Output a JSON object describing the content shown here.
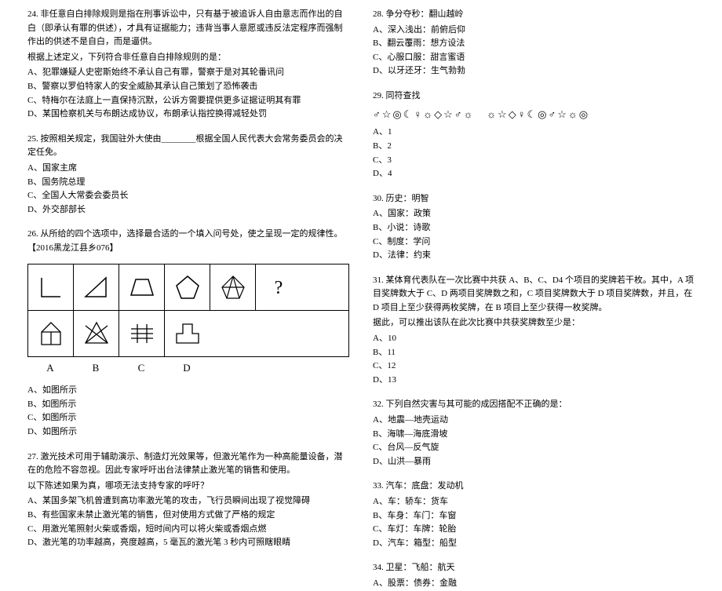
{
  "left": {
    "q24": {
      "text": "24. 非任意自白排除规则是指在刑事诉讼中，只有基于被追诉人自由意志而作出的自白（即承认有罪的供述），才具有证据能力；违背当事人意愿或违反法定程序而强制作出的供述不是自白，而是逼供。",
      "sub": "根据上述定义，下列符合非任意自白排除规则的是：",
      "a": "A、犯罪嫌疑人史密斯始终不承认自己有罪，警察于是对其轮番讯问",
      "b": "B、警察以罗伯特家人的安全威胁其承认自己策划了恐怖袭击",
      "c": "C、特梅尔在法庭上一直保持沉默，公诉方需要提供更多证据证明其有罪",
      "d": "D、某国检察机关与布朗达成协议，布朗承认指控换得减轻处罚"
    },
    "q25": {
      "text": "25. 按照相关规定，我国驻外大使由________根据全国人民代表大会常务委员会的决定任免。",
      "a": "A、国家主席",
      "b": "B、国务院总理",
      "c": "C、全国人大常委会委员长",
      "d": "D、外交部部长"
    },
    "q26": {
      "text": "26. 从所给的四个选项中，选择最合适的一个填入问号处，使之呈现一定的规律性。【2016黑龙江县乡076】",
      "a": "A、如图所示",
      "b": "B、如图所示",
      "c": "C、如图所示",
      "d": "D、如图所示",
      "labelA": "A",
      "labelB": "B",
      "labelC": "C",
      "labelD": "D"
    },
    "q27": {
      "text": "27. 激光技术可用于辅助演示、制造灯光效果等，但激光笔作为一种高能量设备，潜在的危险不容忽视。因此专家呼吁出台法律禁止激光笔的销售和使用。",
      "sub": "以下陈述如果为真，哪项无法支持专家的呼吁？",
      "a": "A、某国多架飞机曾遭到高功率激光笔的攻击，飞行员瞬间出现了视觉障碍",
      "b": "B、有些国家未禁止激光笔的销售，但对使用方式做了严格的规定",
      "c": "C、用激光笔照射火柴或香烟，短时间内可以将火柴或香烟点燃",
      "d": "D、激光笔的功率越高，亮度越高，5 毫瓦的激光笔 3 秒内可照瞎眼睛"
    }
  },
  "right": {
    "q28": {
      "text": "28. 争分夺秒：翻山越岭",
      "a": "A、深入浅出：前俯后仰",
      "b": "B、翻云覆雨：想方设法",
      "c": "C、心服口服：甜言蜜语",
      "d": "D、以牙还牙：生气勃勃"
    },
    "q29": {
      "text": "29. 同符查找",
      "a": "A、1",
      "b": "B、2",
      "c": "C、3",
      "d": "D、4"
    },
    "q30": {
      "text": "30. 历史：明智",
      "a": "A、国家：政策",
      "b": "B、小说：诗歌",
      "c": "C、制度：学问",
      "d": "D、法律：约束"
    },
    "q31": {
      "text": "31. 某体育代表队在一次比赛中共获 A、B、C、D4 个项目的奖牌若干枚。其中，A 项目奖牌数大于 C、D 两项目奖牌数之和，C 项目奖牌数大于 D 项目奖牌数，并且，在 D 项目上至少获得两枚奖牌，在 B 项目上至少获得一枚奖牌。",
      "sub": "据此，可以推出该队在此次比赛中共获奖牌数至少是：",
      "a": "A、10",
      "b": "B、11",
      "c": "C、12",
      "d": "D、13"
    },
    "q32": {
      "text": "32. 下列自然灾害与其可能的成因搭配不正确的是：",
      "a": "A、地震—地壳运动",
      "b": "B、海啸—海底滑坡",
      "c": "C、台风—反气旋",
      "d": "D、山洪—暴雨"
    },
    "q33": {
      "text": "33. 汽车：底盘：发动机",
      "a": "A、车：轿车：货车",
      "b": "B、车身：车门：车窗",
      "c": "C、车灯：车牌：轮胎",
      "d": "D、汽车：箱型：船型"
    },
    "q34": {
      "text": "34. 卫星：飞船：航天",
      "a": "A、股票：债券：金融"
    }
  }
}
